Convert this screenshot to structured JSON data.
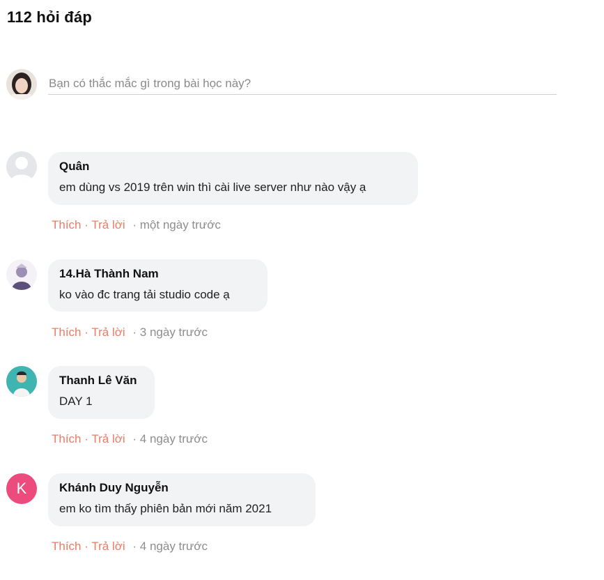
{
  "header": {
    "title": "112 hỏi đáp"
  },
  "composer": {
    "placeholder": "Bạn có thắc mắc gì trong bài học này?"
  },
  "actions": {
    "like": "Thích",
    "reply": "Trả lời",
    "dot": "·"
  },
  "comments": [
    {
      "author": "Quân",
      "content": "em dùng vs 2019 trên win thì cài live server như nào vậy ạ",
      "time": "· một ngày trước"
    },
    {
      "author": "14.Hà Thành Nam",
      "content": "ko vào đc trang tải studio code ạ",
      "time": "· 3 ngày trước"
    },
    {
      "author": "Thanh Lê Văn",
      "content": "DAY 1",
      "time": "· 4 ngày trước"
    },
    {
      "author": "Khánh Duy Nguyễn",
      "content": "em ko tìm thấy phiên bản mới năm 2021",
      "time": "· 4 ngày trước",
      "avatar_letter": "K"
    }
  ],
  "colors": {
    "accent": "#ee7b63",
    "bubble": "#f2f3f5",
    "avatar_k": "#ec4b7d"
  }
}
